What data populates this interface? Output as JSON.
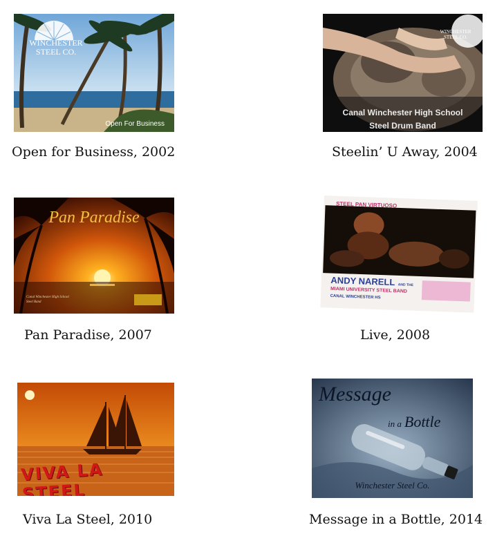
{
  "albums": [
    {
      "caption": "Open for Business, 2002",
      "cover_text": [
        "WINCHESTER",
        "STEEL CO.",
        "Open For Business"
      ]
    },
    {
      "caption": "Steelin’ U Away, 2004",
      "cover_text": [
        "WINCHESTER",
        "STEEL CO.",
        "Canal Winchester High School",
        "Steel Drum Band"
      ]
    },
    {
      "caption": "Pan Paradise, 2007",
      "cover_text": [
        "Pan Paradise",
        "Canal Winchester High School",
        "Steel Band"
      ]
    },
    {
      "caption": "Live, 2008",
      "cover_text": [
        "STEEL PAN VIRTUOSO",
        "ANDY NARELL",
        "AND THE",
        "MIAMI UNIVERSITY STEEL BAND",
        "CANAL WINCHESTER HS"
      ]
    },
    {
      "caption": "Viva La Steel, 2010",
      "cover_text": [
        "VIVA LA STEEL"
      ]
    },
    {
      "caption": "Message in a Bottle, 2014",
      "cover_text": [
        "Message",
        "in a",
        "Bottle",
        "Winchester Steel Co."
      ]
    }
  ]
}
